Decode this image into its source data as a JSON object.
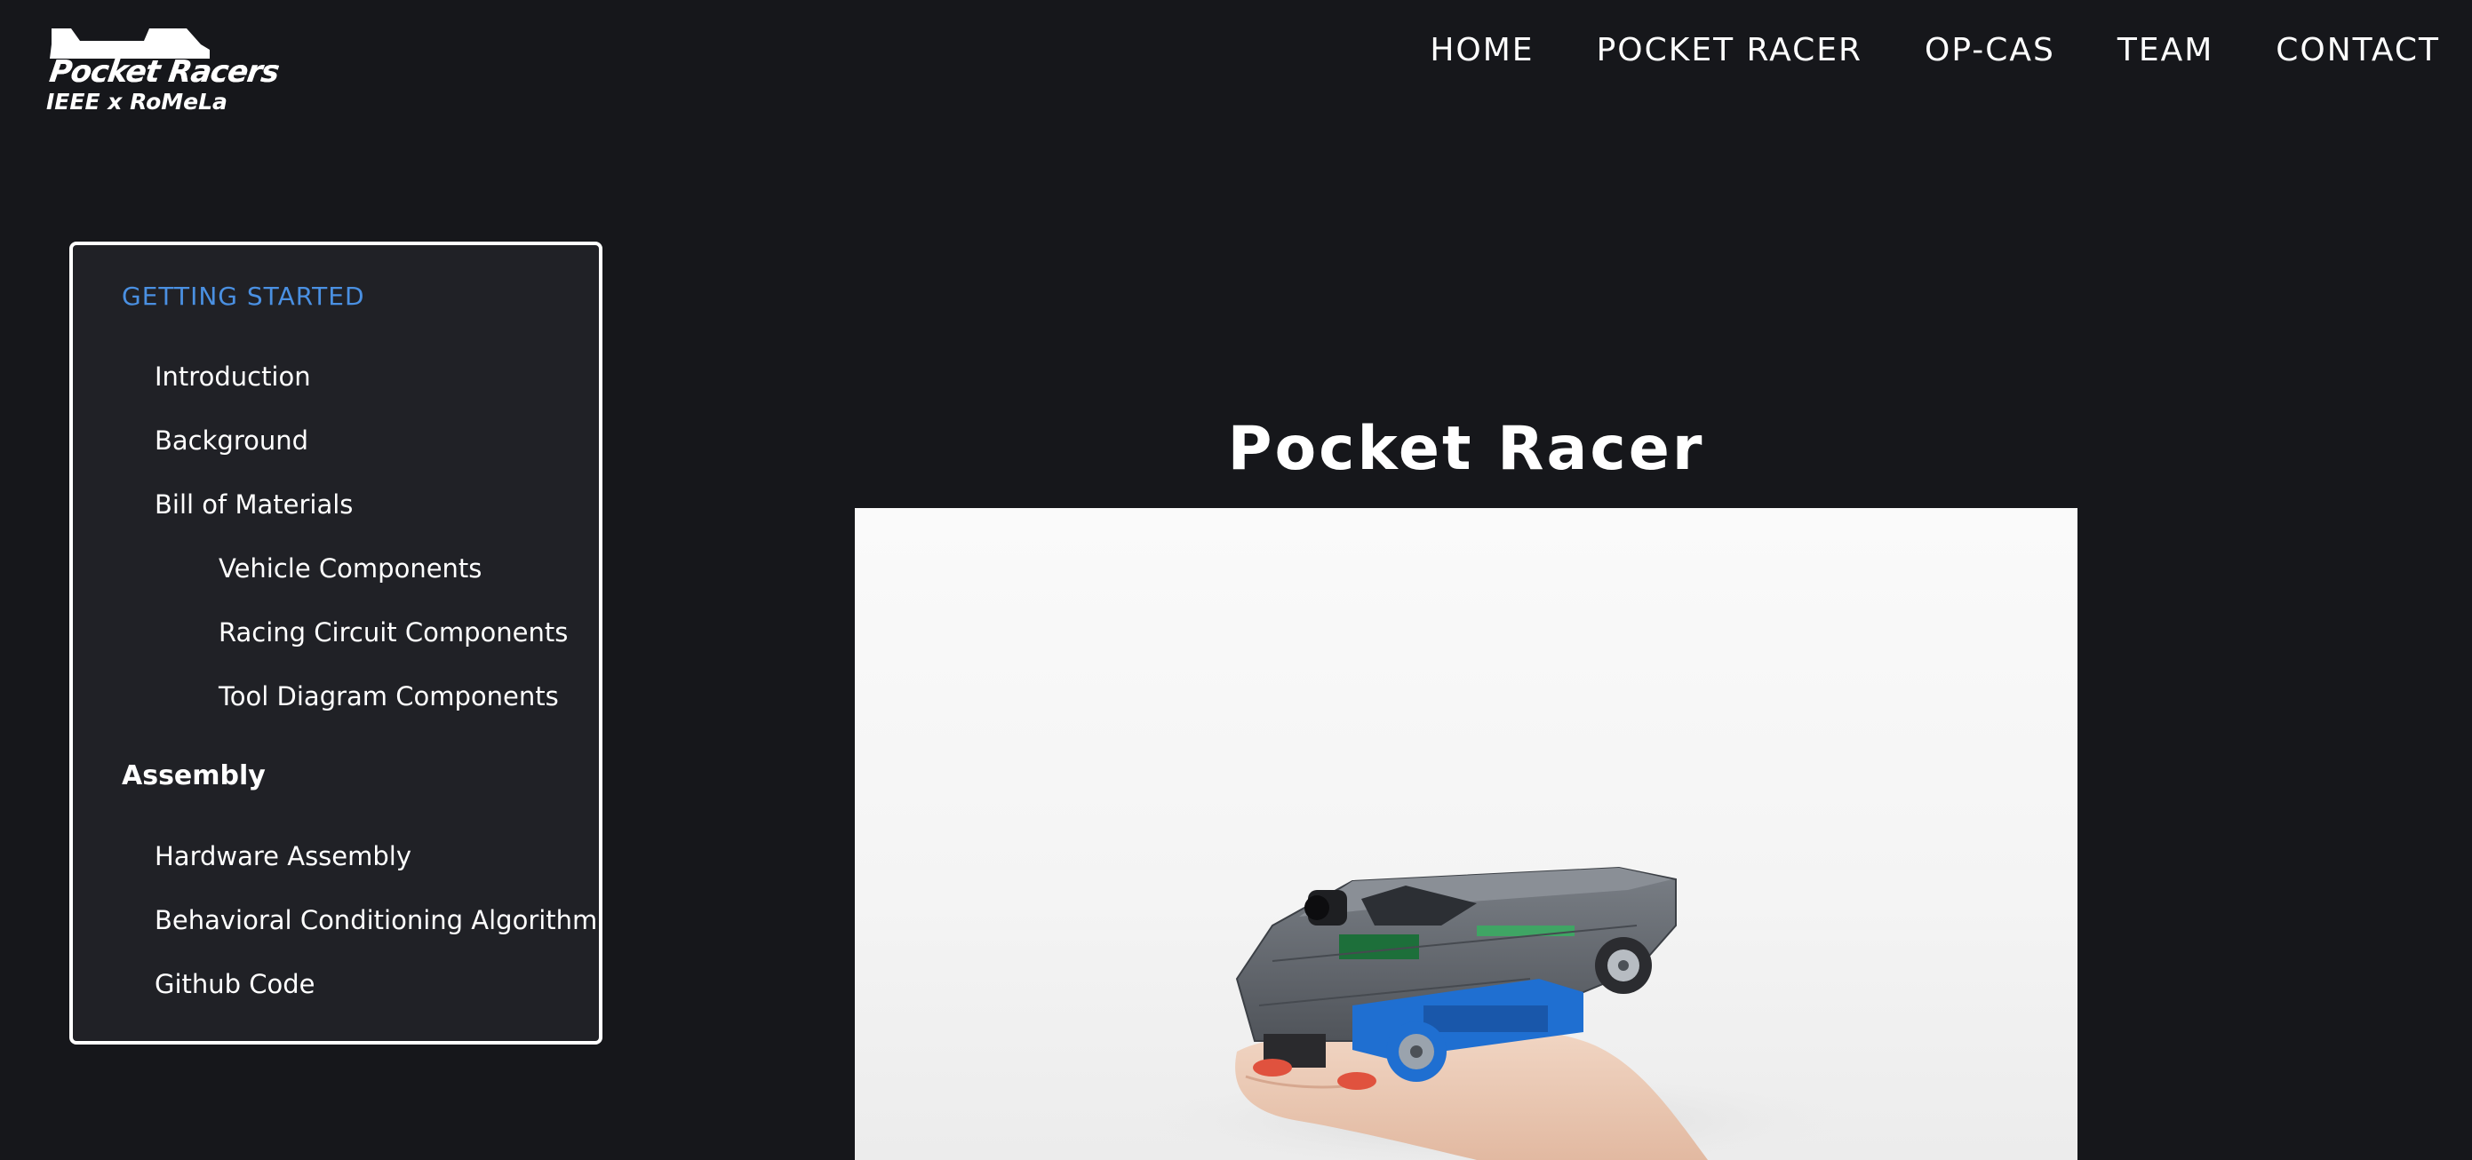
{
  "logo": {
    "title": "Pocket Racers",
    "subtitle": "IEEE x RoMeLa"
  },
  "nav": {
    "items": [
      "HOME",
      "POCKET RACER",
      "OP-CAS",
      "TEAM",
      "CONTACT"
    ]
  },
  "sidebar": {
    "heading": "GETTING STARTED",
    "items": [
      {
        "label": "Introduction"
      },
      {
        "label": "Background"
      },
      {
        "label": "Bill of Materials"
      },
      {
        "label": "Vehicle Components"
      },
      {
        "label": "Racing Circuit Components"
      },
      {
        "label": "Tool Diagram Components"
      }
    ],
    "section2": "Assembly",
    "items2": [
      {
        "label": "Hardware Assembly"
      },
      {
        "label": "Behavioral Conditioning Algorithm"
      },
      {
        "label": "Github Code"
      }
    ]
  },
  "main": {
    "title": "Pocket Racer",
    "hero_alt": "Pocket racer car held in a hand"
  },
  "colors": {
    "background": "#16171b",
    "sidebar_bg": "#202126",
    "accent": "#4a90e2",
    "text": "#ffffff"
  }
}
